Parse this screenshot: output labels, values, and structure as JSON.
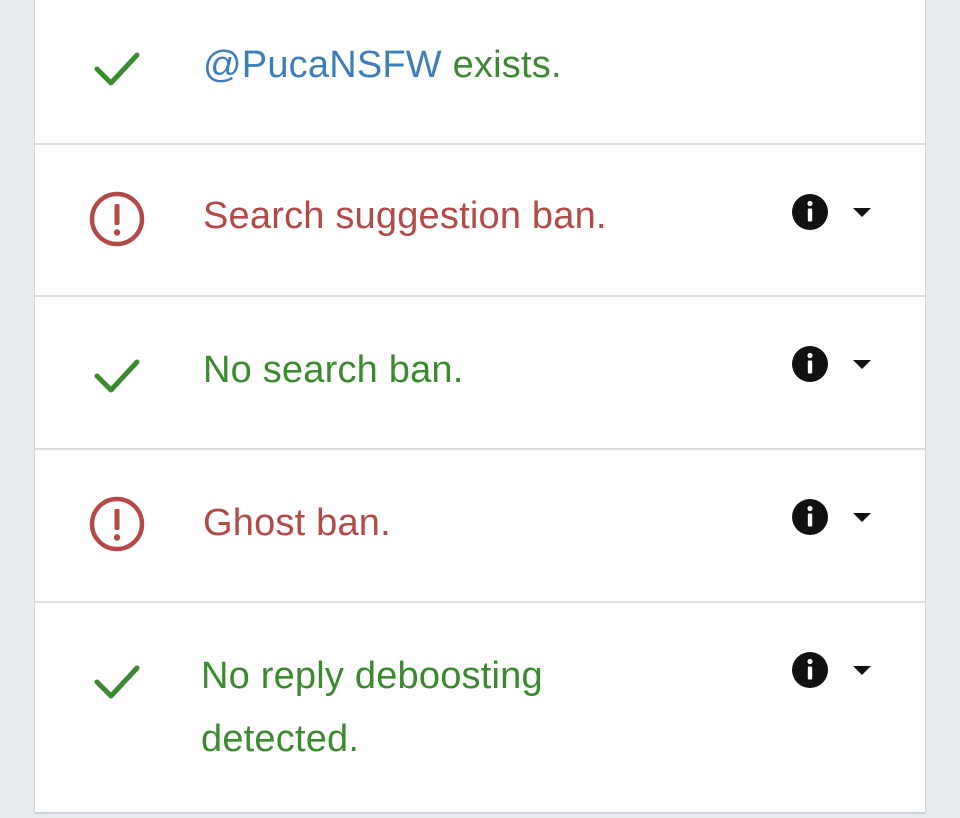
{
  "results": [
    {
      "status": "ok",
      "icon": "checkmark-icon",
      "handle": "@PucaNSFW",
      "text": " exists.",
      "has_details": false
    },
    {
      "status": "bad",
      "icon": "alert-circle-icon",
      "text": "Search suggestion ban.",
      "has_details": true
    },
    {
      "status": "ok",
      "icon": "checkmark-icon",
      "text": "No search ban.",
      "has_details": true
    },
    {
      "status": "bad",
      "icon": "alert-circle-icon",
      "text": "Ghost ban.",
      "has_details": true
    },
    {
      "status": "ok",
      "icon": "checkmark-icon",
      "text": "No reply deboosting detected.",
      "has_details": true
    }
  ],
  "colors": {
    "ok": "#3a8a2e",
    "bad": "#b44a47",
    "handle": "#3d7fb8",
    "background": "#e8ebef",
    "panel": "#ffffff"
  }
}
